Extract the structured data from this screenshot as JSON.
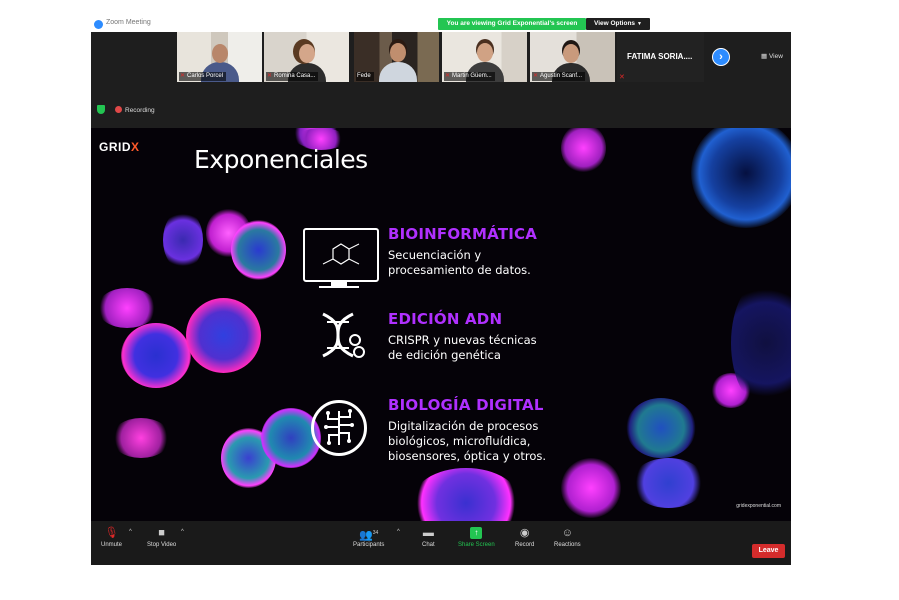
{
  "window": {
    "title": "Zoom Meeting"
  },
  "banner": {
    "sharing_text": "You are viewing Grid Exponential's screen",
    "view_options": "View Options"
  },
  "participants": [
    {
      "name": "Carlos Porcel"
    },
    {
      "name": "Romina Casa..."
    },
    {
      "name": "Fede"
    },
    {
      "name": "Martin Güem..."
    },
    {
      "name": "Agustin Scanf..."
    }
  ],
  "fatima": {
    "name": "FATIMA SORIA...."
  },
  "strip": {
    "view_label": "View"
  },
  "recording": {
    "label": "Recording"
  },
  "slide": {
    "logo_main": "GRID",
    "logo_x": "X",
    "title": "Exponenciales",
    "items": [
      {
        "title": "BIOINFORMÁTICA",
        "desc_line1": "Secuenciación y",
        "desc_line2": "procesamiento de datos.",
        "desc_line3": ""
      },
      {
        "title": "EDICIÓN ADN",
        "desc_line1": "CRISPR y nuevas técnicas",
        "desc_line2": "de edición genética",
        "desc_line3": ""
      },
      {
        "title": "BIOLOGÍA DIGITAL",
        "desc_line1": "Digitalización de procesos",
        "desc_line2": "biológicos, microfluídica,",
        "desc_line3": "biosensores, óptica y otros."
      }
    ],
    "footer_url": "gridexponential.com"
  },
  "toolbar": {
    "unmute": "Unmute",
    "stop_video": "Stop Video",
    "participants": "Participants",
    "participant_count": "34",
    "chat": "Chat",
    "share_screen": "Share Screen",
    "record": "Record",
    "reactions": "Reactions",
    "leave": "Leave"
  },
  "colors": {
    "share_green": "#23c552",
    "zoom_blue": "#2d8cff",
    "leave_red": "#d42c2c",
    "accent_purple": "#b030ff"
  }
}
